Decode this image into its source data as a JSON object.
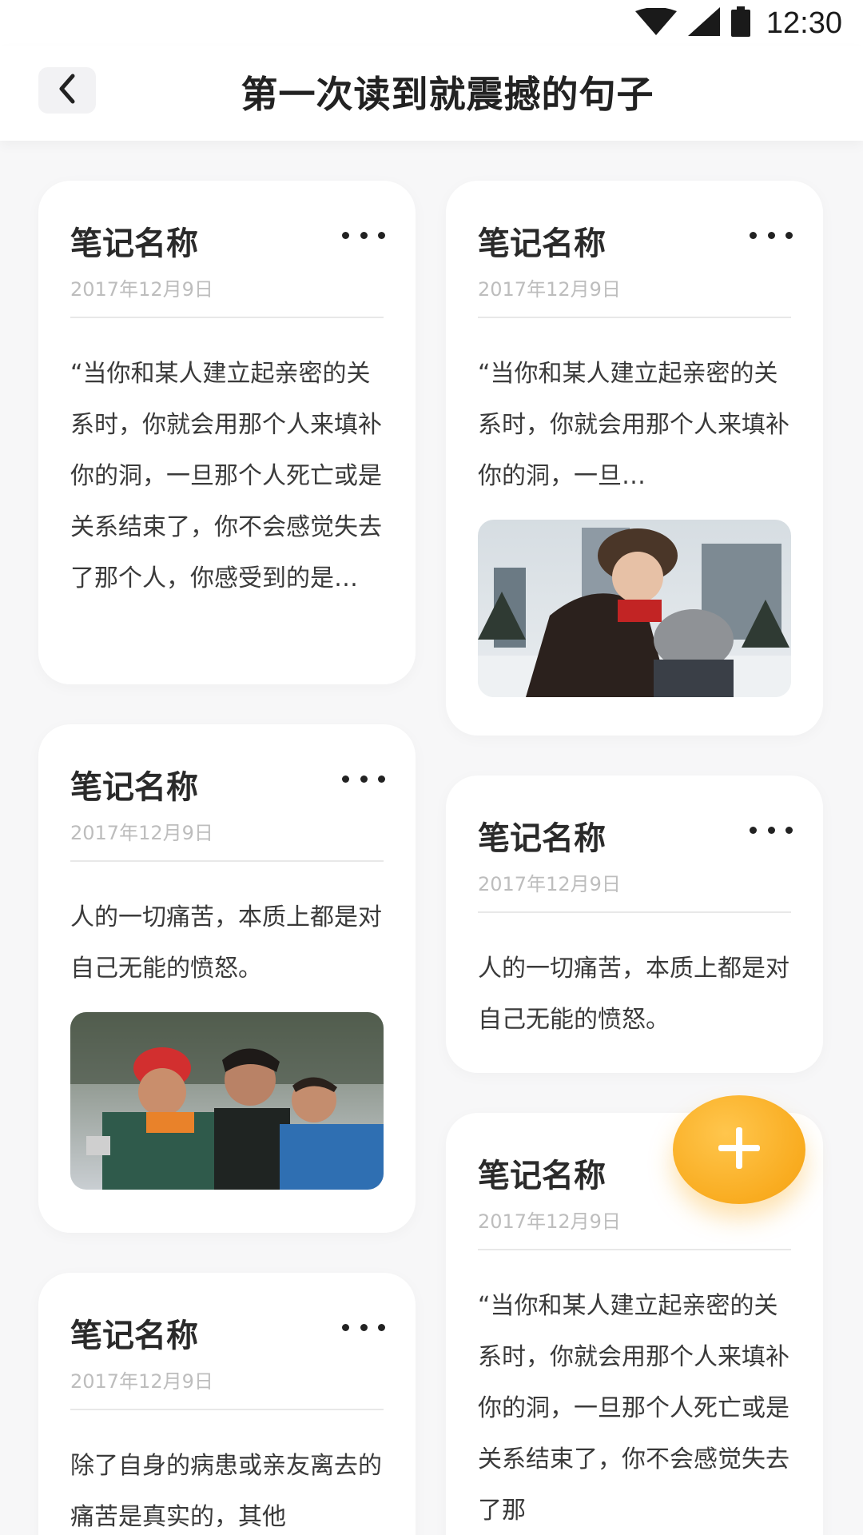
{
  "status_bar": {
    "time": "12:30",
    "icons": [
      "wifi-icon",
      "cellular-signal-icon",
      "battery-icon"
    ]
  },
  "header": {
    "title": "第一次读到就震撼的句子",
    "back_icon": "chevron-left-icon"
  },
  "colors": {
    "background": "#f7f7f8",
    "card": "#ffffff",
    "accent": "#f9ac20",
    "date_text": "#bdbdbd"
  },
  "notes": [
    {
      "title": "笔记名称",
      "date": "2017年12月9日",
      "text": "“当你和某人建立起亲密的关系时，你就会用那个人来填补你的洞，一旦那个人死亡或是关系结束了，你不会感觉失去了那个人，你感受到的是…",
      "photo": null
    },
    {
      "title": "笔记名称",
      "date": "2017年12月9日",
      "text": "“当你和某人建立起亲密的关系时，你就会用那个人来填补你的洞，一旦…",
      "photo": "photo-woman-snow"
    },
    {
      "title": "笔记名称",
      "date": "2017年12月9日",
      "text": "人的一切痛苦，本质上都是对自己无能的愤怒。",
      "photo": "photo-three-boys"
    },
    {
      "title": "笔记名称",
      "date": "2017年12月9日",
      "text": "人的一切痛苦，本质上都是对自己无能的愤怒。",
      "photo": null
    },
    {
      "title": "笔记名称",
      "date": "2017年12月9日",
      "text": "除了自身的病患或亲友离去的痛苦是真实的，其他",
      "photo": null
    },
    {
      "title": "笔记名称",
      "date": "2017年12月9日",
      "text": "“当你和某人建立起亲密的关系时，你就会用那个人来填补你的洞，一旦那个人死亡或是关系结束了，你不会感觉失去了那",
      "photo": null
    }
  ],
  "fab": {
    "icon": "plus-icon"
  }
}
